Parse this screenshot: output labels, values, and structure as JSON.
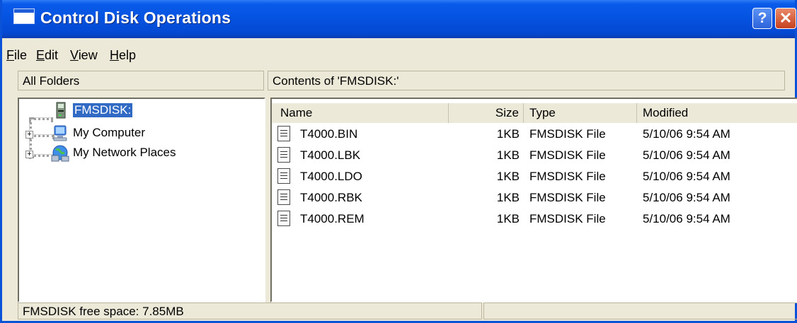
{
  "window": {
    "title": "Control Disk Operations"
  },
  "titlebar": {
    "help_label": "?",
    "close_label": "✕"
  },
  "menu": [
    {
      "accel": "F",
      "rest": "ile"
    },
    {
      "accel": "E",
      "rest": "dit"
    },
    {
      "accel": "V",
      "rest": "iew"
    },
    {
      "accel": "H",
      "rest": "elp"
    }
  ],
  "left_panel": {
    "header": "All Folders",
    "tree": [
      {
        "label": "FMSDISK:",
        "icon": "drive-icon",
        "selected": true
      },
      {
        "label": "My Computer",
        "icon": "computer-icon",
        "expandable": true
      },
      {
        "label": "My Network Places",
        "icon": "network-icon",
        "expandable": true
      }
    ]
  },
  "right_panel": {
    "header": "Contents of 'FMSDISK:'",
    "columns": [
      "Name",
      "Size",
      "Type",
      "Modified"
    ],
    "files": [
      {
        "name": "T4000.BIN",
        "size": "1KB",
        "type": "FMSDISK File",
        "modified": "5/10/06 9:54 AM"
      },
      {
        "name": "T4000.LBK",
        "size": "1KB",
        "type": "FMSDISK File",
        "modified": "5/10/06 9:54 AM"
      },
      {
        "name": "T4000.LDO",
        "size": "1KB",
        "type": "FMSDISK File",
        "modified": "5/10/06 9:54 AM"
      },
      {
        "name": "T4000.RBK",
        "size": "1KB",
        "type": "FMSDISK File",
        "modified": "5/10/06 9:54 AM"
      },
      {
        "name": "T4000.REM",
        "size": "1KB",
        "type": "FMSDISK File",
        "modified": "5/10/06 9:54 AM"
      }
    ]
  },
  "status": {
    "text": "FMSDISK free space: 7.85MB"
  },
  "colors": {
    "title_blue": "#0552e0",
    "selection": "#316ac5",
    "face": "#ece9d8"
  }
}
